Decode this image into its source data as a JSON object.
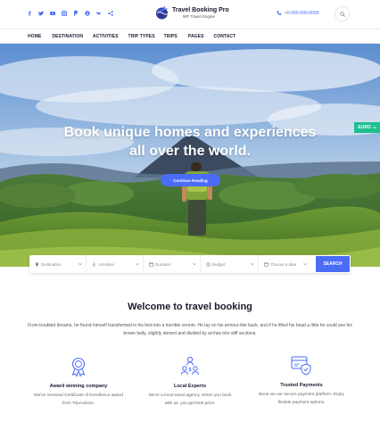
{
  "header": {
    "social_icons": [
      "facebook-icon",
      "twitter-icon",
      "youtube-icon",
      "instagram-icon",
      "foursquare-icon",
      "skype-icon",
      "vk-icon",
      "share-icon"
    ],
    "logo": {
      "title": "Travel Booking Pro",
      "subtitle": "WP Travel Engine"
    },
    "phone": "+0-000-000-0000"
  },
  "nav": {
    "items": [
      "HOME",
      "DESTINATION",
      "ACTIVITIES",
      "TRIP TYPES",
      "TRIPS",
      "PAGES",
      "CONTACT"
    ]
  },
  "hero": {
    "title_line1": "Book unique homes and experiences",
    "title_line2": "all over the world.",
    "cta_label": "Continue Reading",
    "currency": "EURO"
  },
  "search_form": {
    "destination": "Destination",
    "activities": "Activities",
    "duration": "Duration",
    "budget": "Budget",
    "date": "Choose a date",
    "submit": "SEARCH"
  },
  "welcome": {
    "title": "Welcome to travel booking",
    "text": "From troubled dreams, he found himself transformed in his bed into a horrible vermin. He lay on his armour-like back, and if he lifted his head a little he could see his brown belly, slightly domed and divided by arches into stiff sections."
  },
  "features": [
    {
      "icon": "award-icon",
      "title": "Award winning company",
      "desc_line1": "We've received Certificate of Excellence award",
      "desc_line2": "from TripAdvisor."
    },
    {
      "icon": "experts-icon",
      "title": "Local Experts",
      "desc_line1": "We're a local travel agency. When you book",
      "desc_line2": "with us, you get best price."
    },
    {
      "icon": "payment-icon",
      "title": "Trusted Payments",
      "desc_line1": "Book via our secure payment platform. Enjoy",
      "desc_line2": "flexible payment options."
    }
  ],
  "colors": {
    "accent": "#4a6cf7",
    "currency_badge": "#1fbf8f",
    "heading": "#1a1a2e"
  }
}
